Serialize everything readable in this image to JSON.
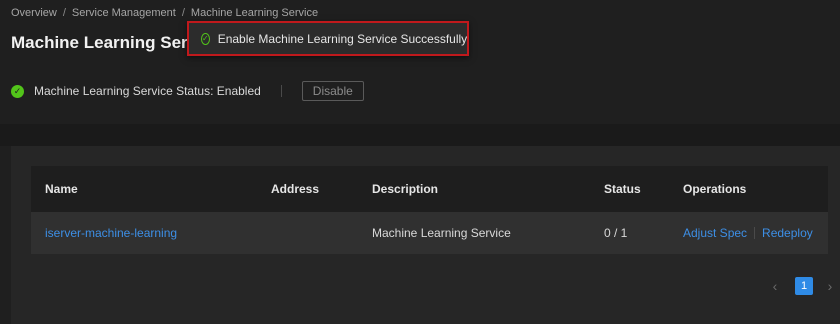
{
  "breadcrumb": {
    "items": [
      "Overview",
      "Service Management",
      "Machine Learning Service"
    ],
    "separator": "/"
  },
  "page_title": "Machine Learning Serv",
  "toast": {
    "message": "Enable Machine Learning Service Successfully",
    "icon": "check-circle-icon"
  },
  "status": {
    "text": "Machine Learning Service Status: Enabled",
    "icon": "check-circle-filled-icon",
    "disable_label": "Disable"
  },
  "table": {
    "headers": {
      "name": "Name",
      "address": "Address",
      "description": "Description",
      "status": "Status",
      "operations": "Operations"
    },
    "rows": [
      {
        "name": "iserver-machine-learning",
        "address": "",
        "description": "Machine Learning Service",
        "status": "0 / 1",
        "op_adjust": "Adjust Spec",
        "op_redeploy": "Redeploy"
      }
    ]
  },
  "pagination": {
    "prev": "‹",
    "current": "1",
    "next": "›"
  },
  "colors": {
    "accent": "#2f8be6",
    "link": "#3d8fe6",
    "success": "#52c41a",
    "highlight_border": "#c0191c"
  }
}
